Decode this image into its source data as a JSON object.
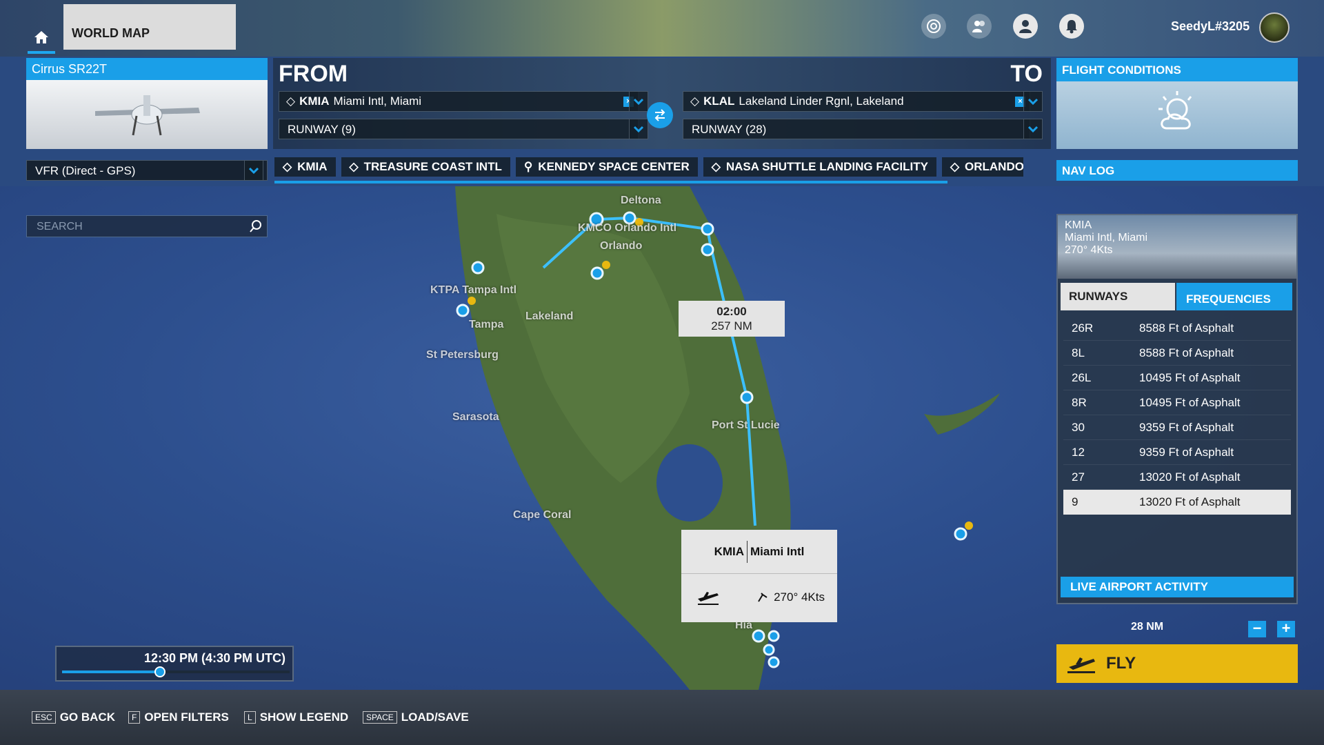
{
  "header": {
    "tab_title": "WORLD MAP",
    "username": "SeedyL#3205"
  },
  "aircraft": {
    "name": "Cirrus SR22T"
  },
  "route": {
    "from_label": "FROM",
    "to_label": "TO",
    "from": {
      "icao": "KMIA",
      "name": "Miami Intl, Miami",
      "runway": "RUNWAY (9)"
    },
    "to": {
      "icao": "KLAL",
      "name": "Lakeland Linder Rgnl, Lakeland",
      "runway": "RUNWAY (28)"
    },
    "clear_glyph": "×"
  },
  "conditions": {
    "title": "FLIGHT CONDITIONS"
  },
  "flight_type": "VFR (Direct - GPS)",
  "waypoints": [
    "KMIA",
    "TREASURE COAST INTL",
    "KENNEDY SPACE CENTER",
    "NASA SHUTTLE LANDING FACILITY",
    "ORLANDO"
  ],
  "nav_log_label": "NAV LOG",
  "search": {
    "placeholder": "SEARCH"
  },
  "airport_info": {
    "icao": "KMIA",
    "name": "Miami Intl, Miami",
    "wind": "270° 4Kts",
    "tab_runways": "RUNWAYS",
    "tab_frequencies": "FREQUENCIES",
    "runways": [
      {
        "id": "26R",
        "desc": "8588 Ft of Asphalt"
      },
      {
        "id": "8L",
        "desc": "8588 Ft of Asphalt"
      },
      {
        "id": "26L",
        "desc": "10495 Ft of Asphalt"
      },
      {
        "id": "8R",
        "desc": "10495 Ft of Asphalt"
      },
      {
        "id": "30",
        "desc": "9359 Ft of Asphalt"
      },
      {
        "id": "12",
        "desc": "9359 Ft of Asphalt"
      },
      {
        "id": "27",
        "desc": "13020 Ft of Asphalt"
      },
      {
        "id": "9",
        "desc": "13020 Ft of Asphalt"
      }
    ],
    "selected_runway": "9",
    "live_activity": "LIVE AIRPORT ACTIVITY"
  },
  "scale_label": "28 NM",
  "zoom": {
    "out": "−",
    "in": "+"
  },
  "fly_label": "FLY",
  "time": {
    "text": "12:30 PM (4:30 PM UTC)",
    "slider_fraction": 0.43
  },
  "leg_tooltip": {
    "time": "02:00",
    "distance": "257 NM"
  },
  "airport_tooltip": {
    "icao": "KMIA",
    "name": "Miami Intl",
    "wind": "270° 4Kts"
  },
  "map_labels": {
    "deltona": "Deltona",
    "kmco": "KMCO Orlando Intl",
    "orlando": "Orlando",
    "ktpa": "KTPA Tampa Intl",
    "tampa": "Tampa",
    "lakeland": "Lakeland",
    "st_petersburg": "St Petersburg",
    "sarasota": "Sarasota",
    "port_st_lucie": "Port St Lucie",
    "cape_coral": "Cape Coral",
    "hialeah": "Hia"
  },
  "bottom_hints": [
    {
      "key": "ESC",
      "label": "GO BACK"
    },
    {
      "key": "F",
      "label": "OPEN FILTERS"
    },
    {
      "key": "L",
      "label": "SHOW LEGEND"
    },
    {
      "key": "SPACE",
      "label": "LOAD/SAVE"
    }
  ],
  "colors": {
    "accent": "#1a9fe8",
    "fly": "#e8b810",
    "route_line": "#3cc0ff"
  }
}
